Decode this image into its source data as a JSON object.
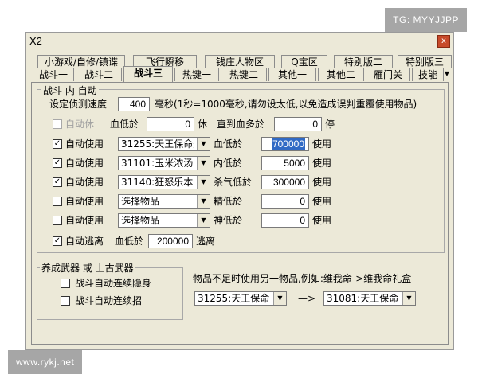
{
  "watermarks": {
    "top": "TG: MYYJJPP",
    "bottom": "www.rykj.net"
  },
  "window": {
    "title": "X2",
    "close_glyph": "x"
  },
  "tabs_row1": [
    "小游戏/自修/镇谍",
    "飞行瞬移",
    "钱庄人物区",
    "Q宝区",
    "特别版二",
    "特别版三"
  ],
  "tabs_row2": [
    "战斗一",
    "战斗二",
    "战斗三",
    "热键一",
    "热键二",
    "其他一",
    "其他二",
    "雁门关",
    "技能"
  ],
  "tab_scroll_glyph": "▼",
  "battle_group": {
    "label": "战斗 内 自动",
    "speed_label": "设定侦测速度",
    "speed_value": "400",
    "speed_hint": "毫秒(1秒=1000毫秒,请勿设太低,以免造成误判重覆使用物品)",
    "rest": {
      "checkbox_label": "自动休",
      "hp_label": "血低於",
      "hp_value": "0",
      "rest_label": "休",
      "until_label": "直到血多於",
      "until_value": "0",
      "stop_label": "停"
    },
    "rows": [
      {
        "checked": true,
        "label": "自动使用",
        "item": "31255:天王保命丹",
        "stat": "血低於",
        "value": "700000",
        "use": "使用",
        "selected": true
      },
      {
        "checked": true,
        "label": "自动使用",
        "item": "31101:玉米浓汤",
        "stat": "内低於",
        "value": "5000",
        "use": "使用",
        "selected": false
      },
      {
        "checked": true,
        "label": "自动使用",
        "item": "31140:狂怒乐本",
        "stat": "杀气低於",
        "value": "300000",
        "use": "使用",
        "selected": false
      },
      {
        "checked": false,
        "label": "自动使用",
        "item": "选择物品",
        "stat": "精低於",
        "value": "0",
        "use": "使用",
        "selected": false
      },
      {
        "checked": false,
        "label": "自动使用",
        "item": "选择物品",
        "stat": "神低於",
        "value": "0",
        "use": "使用",
        "selected": false
      }
    ],
    "escape": {
      "checked": true,
      "label": "自动逃离",
      "hp_label": "血低於",
      "value": "200000",
      "action": "逃离"
    }
  },
  "weapon_group": {
    "label": "养成武器 或 上古武器",
    "options": [
      {
        "checked": false,
        "label": "战斗自动连续隐身"
      },
      {
        "checked": false,
        "label": "战斗自动连续招"
      }
    ]
  },
  "substitute": {
    "label": "物品不足时使用另一物品,例如:维我命->维我命礼盒",
    "from_item": "31255:天王保命丹",
    "arrow": "—>",
    "to_item": "31081:天王保命丹"
  },
  "check_glyph": "✓"
}
